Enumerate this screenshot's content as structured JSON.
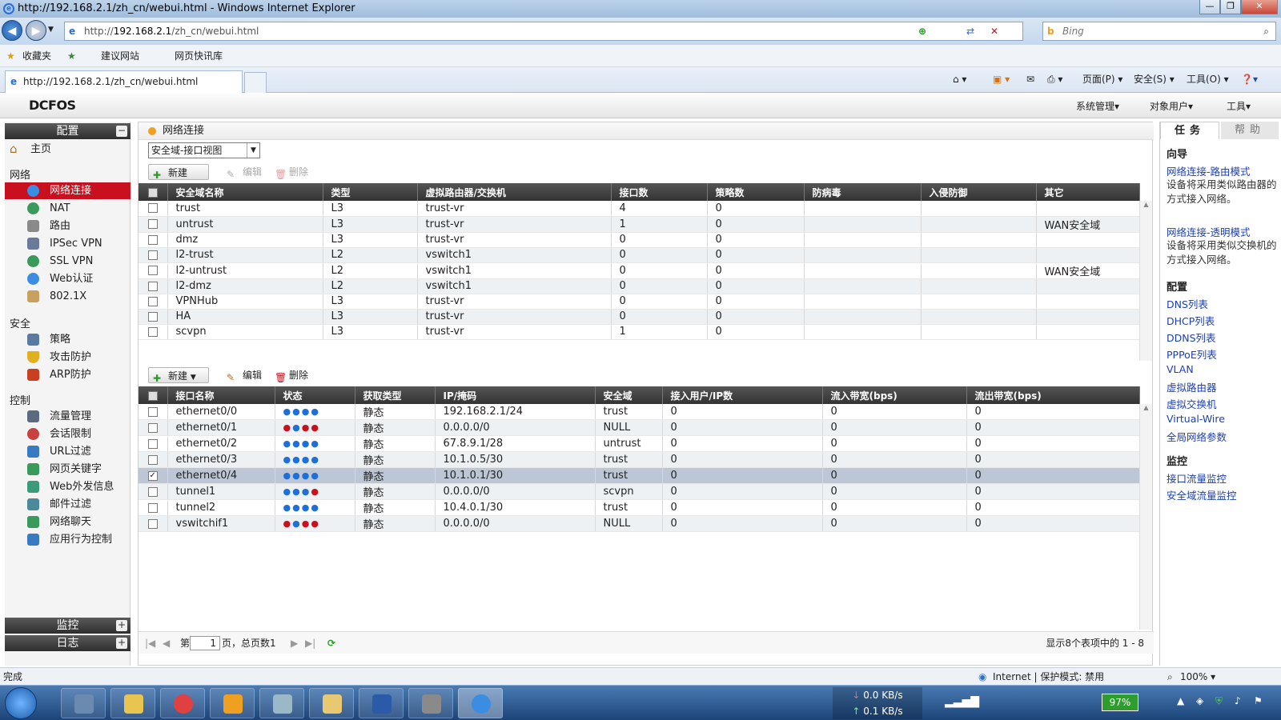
{
  "window": {
    "title": "http://192.168.2.1/zh_cn/webui.html - Windows Internet Explorer"
  },
  "browser": {
    "address": {
      "prefix": "http://",
      "host": "192.168.2.1",
      "path": "/zh_cn/webui.html"
    },
    "search_placeholder": "Bing",
    "favorites": {
      "fav": "收藏夹",
      "suggested": "建议网站",
      "slices": "网页快讯库"
    },
    "tab_title": "http://192.168.2.1/zh_cn/webui.html",
    "commands": {
      "page": "页面(P)",
      "safety": "安全(S)",
      "tools": "工具(O)"
    }
  },
  "app": {
    "logo": "DCFOS",
    "top_menu": [
      "系统管理",
      "对象用户",
      "工具"
    ],
    "sidebar": {
      "config_header": "配置",
      "home": "主页",
      "sections": [
        {
          "title": "网络",
          "items": [
            "网络连接",
            "NAT",
            "路由",
            "IPSec VPN",
            "SSL VPN",
            "Web认证",
            "802.1X"
          ]
        },
        {
          "title": "安全",
          "items": [
            "策略",
            "攻击防护",
            "ARP防护"
          ]
        },
        {
          "title": "控制",
          "items": [
            "流量管理",
            "会话限制",
            "URL过滤",
            "网页关键字",
            "Web外发信息",
            "邮件过滤",
            "网络聊天",
            "应用行为控制"
          ]
        }
      ],
      "monitor_header": "监控",
      "log_header": "日志"
    },
    "main": {
      "breadcrumb": "网络连接",
      "view_select": "安全域-接口视图",
      "toolbar1": {
        "new": "新建",
        "edit": "编辑",
        "delete": "删除"
      },
      "toolbar2": {
        "new": "新建",
        "edit": "编辑",
        "delete": "删除"
      },
      "zones_table": {
        "columns": [
          "安全域名称",
          "类型",
          "虚拟路由器/交换机",
          "接口数",
          "策略数",
          "防病毒",
          "入侵防御",
          "其它"
        ],
        "rows": [
          [
            "trust",
            "L3",
            "trust-vr",
            "4",
            "0",
            "",
            "",
            ""
          ],
          [
            "untrust",
            "L3",
            "trust-vr",
            "1",
            "0",
            "",
            "",
            "WAN安全域"
          ],
          [
            "dmz",
            "L3",
            "trust-vr",
            "0",
            "0",
            "",
            "",
            ""
          ],
          [
            "l2-trust",
            "L2",
            "vswitch1",
            "0",
            "0",
            "",
            "",
            ""
          ],
          [
            "l2-untrust",
            "L2",
            "vswitch1",
            "0",
            "0",
            "",
            "",
            "WAN安全域"
          ],
          [
            "l2-dmz",
            "L2",
            "vswitch1",
            "0",
            "0",
            "",
            "",
            ""
          ],
          [
            "VPNHub",
            "L3",
            "trust-vr",
            "0",
            "0",
            "",
            "",
            ""
          ],
          [
            "HA",
            "L3",
            "trust-vr",
            "0",
            "0",
            "",
            "",
            ""
          ],
          [
            "scvpn",
            "L3",
            "trust-vr",
            "1",
            "0",
            "",
            "",
            ""
          ]
        ]
      },
      "if_table": {
        "columns": [
          "接口名称",
          "状态",
          "获取类型",
          "IP/掩码",
          "安全域",
          "接入用户/IP数",
          "流入带宽(bps)",
          "流出带宽(bps)"
        ],
        "rows": [
          {
            "cells": [
              "ethernet0/0",
              "静态",
              "192.168.2.1/24",
              "trust",
              "0",
              "0",
              "0"
            ],
            "status": [
              "b",
              "b",
              "b",
              "b"
            ],
            "checked": false
          },
          {
            "cells": [
              "ethernet0/1",
              "静态",
              "0.0.0.0/0",
              "NULL",
              "0",
              "0",
              "0"
            ],
            "status": [
              "r",
              "b",
              "r",
              "r"
            ],
            "checked": false
          },
          {
            "cells": [
              "ethernet0/2",
              "静态",
              "67.8.9.1/28",
              "untrust",
              "0",
              "0",
              "0"
            ],
            "status": [
              "b",
              "b",
              "b",
              "b"
            ],
            "checked": false
          },
          {
            "cells": [
              "ethernet0/3",
              "静态",
              "10.1.0.5/30",
              "trust",
              "0",
              "0",
              "0"
            ],
            "status": [
              "b",
              "b",
              "b",
              "b"
            ],
            "checked": false
          },
          {
            "cells": [
              "ethernet0/4",
              "静态",
              "10.1.0.1/30",
              "trust",
              "0",
              "0",
              "0"
            ],
            "status": [
              "b",
              "b",
              "b",
              "b"
            ],
            "checked": true
          },
          {
            "cells": [
              "tunnel1",
              "静态",
              "0.0.0.0/0",
              "scvpn",
              "0",
              "0",
              "0"
            ],
            "status": [
              "b",
              "b",
              "b",
              "r"
            ],
            "checked": false
          },
          {
            "cells": [
              "tunnel2",
              "静态",
              "10.4.0.1/30",
              "trust",
              "0",
              "0",
              "0"
            ],
            "status": [
              "b",
              "b",
              "b",
              "b"
            ],
            "checked": false
          },
          {
            "cells": [
              "vswitchif1",
              "静态",
              "0.0.0.0/0",
              "NULL",
              "0",
              "0",
              "0"
            ],
            "status": [
              "r",
              "b",
              "r",
              "r"
            ],
            "checked": false
          }
        ]
      },
      "pager": {
        "page_prefix": "第",
        "page_value": "1",
        "page_suffix": "页，总页数1",
        "summary": "显示8个表项中的 1 - 8"
      }
    },
    "right_panel": {
      "tabs": [
        "任务",
        "帮助"
      ],
      "guide_title": "向导",
      "guides": [
        {
          "link": "网络连接-路由模式",
          "desc": "设备将采用类似路由器的方式接入网络。"
        },
        {
          "link": "网络连接-透明模式",
          "desc": "设备将采用类似交换机的方式接入网络。"
        }
      ],
      "config_title": "配置",
      "config_links": [
        "DNS列表",
        "DHCP列表",
        "DDNS列表",
        "PPPoE列表",
        "VLAN",
        "虚拟路由器",
        "虚拟交换机",
        "Virtual-Wire",
        "全局网络参数"
      ],
      "monitor_title": "监控",
      "monitor_links": [
        "接口流量监控",
        "安全域流量监控"
      ]
    }
  },
  "statusbar": {
    "left": "完成",
    "zone": "Internet | 保护模式: 禁用",
    "zoom": "100%"
  },
  "taskbar": {
    "down": "0.0 KB/s",
    "up": "0.1 KB/s",
    "battery": "97%"
  }
}
